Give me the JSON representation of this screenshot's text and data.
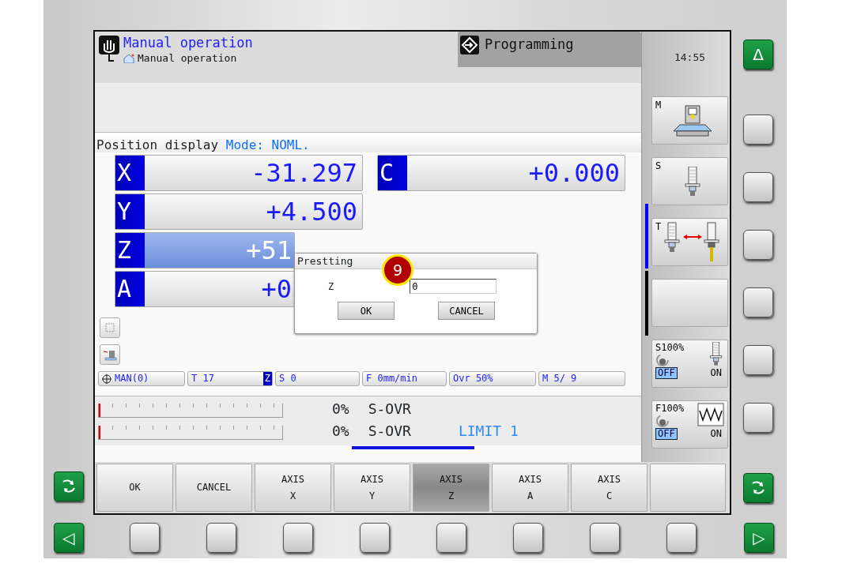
{
  "header": {
    "tabs": [
      {
        "label": "Manual operation",
        "selected": true
      },
      {
        "label": "Programming",
        "selected": false
      }
    ],
    "breadcrumb": "Manual operation"
  },
  "position_display": {
    "label": "Position display",
    "mode": "Mode: NOML."
  },
  "axes_left": [
    {
      "axis": "X",
      "value": "-31.297",
      "selected": false
    },
    {
      "axis": "Y",
      "value": "+4.500",
      "selected": false
    },
    {
      "axis": "Z",
      "value": "+51",
      "selected": true
    },
    {
      "axis": "A",
      "value": "+0",
      "selected": false
    }
  ],
  "axes_right": [
    {
      "axis": "C",
      "value": "+0.000",
      "selected": false
    }
  ],
  "status_bar": [
    {
      "kind": "mode",
      "text": "MAN(0)"
    },
    {
      "kind": "tool",
      "text": "T 17",
      "axis": "Z"
    },
    {
      "kind": "plain",
      "text": "S 0"
    },
    {
      "kind": "plain",
      "text": "F 0mm/min"
    },
    {
      "kind": "plain",
      "text": "Ovr  50%"
    },
    {
      "kind": "plain",
      "text": "M 5/ 9"
    }
  ],
  "load": [
    {
      "level": 0,
      "percent": "0%",
      "label": "S-OVR"
    },
    {
      "level": 0,
      "percent": "0%",
      "label": "S-OVR",
      "limit": "LIMIT 1"
    }
  ],
  "dialog": {
    "title": "Prestting",
    "field_label": "Z",
    "value": "0",
    "buttons": [
      "OK",
      "CANCEL"
    ],
    "marker": "9"
  },
  "softkeys": [
    {
      "lines": [
        "OK"
      ],
      "selected": false
    },
    {
      "lines": [
        "CANCEL"
      ],
      "selected": false
    },
    {
      "lines": [
        "AXIS",
        "X"
      ],
      "selected": false
    },
    {
      "lines": [
        "AXIS",
        "Y"
      ],
      "selected": false
    },
    {
      "lines": [
        "AXIS",
        "Z"
      ],
      "selected": true
    },
    {
      "lines": [
        "AXIS",
        "A"
      ],
      "selected": false
    },
    {
      "lines": [
        "AXIS",
        "C"
      ],
      "selected": false
    }
  ],
  "sidebar": {
    "clock": "14:55",
    "buttons": [
      {
        "kind": "machine",
        "label": "M"
      },
      {
        "kind": "spindle",
        "label": "S"
      },
      {
        "kind": "tool-change",
        "label": "T"
      },
      {
        "kind": "blank"
      },
      {
        "kind": "spindle-override",
        "label": "S100%",
        "off": "OFF",
        "on": "ON",
        "switch_on": false
      },
      {
        "kind": "feed-override",
        "label": "F100%",
        "off": "OFF",
        "on": "ON",
        "switch_on": false
      }
    ]
  },
  "bezel": {
    "right_top": "Δ",
    "bottom_left": "◁",
    "bottom_right": "▷"
  }
}
